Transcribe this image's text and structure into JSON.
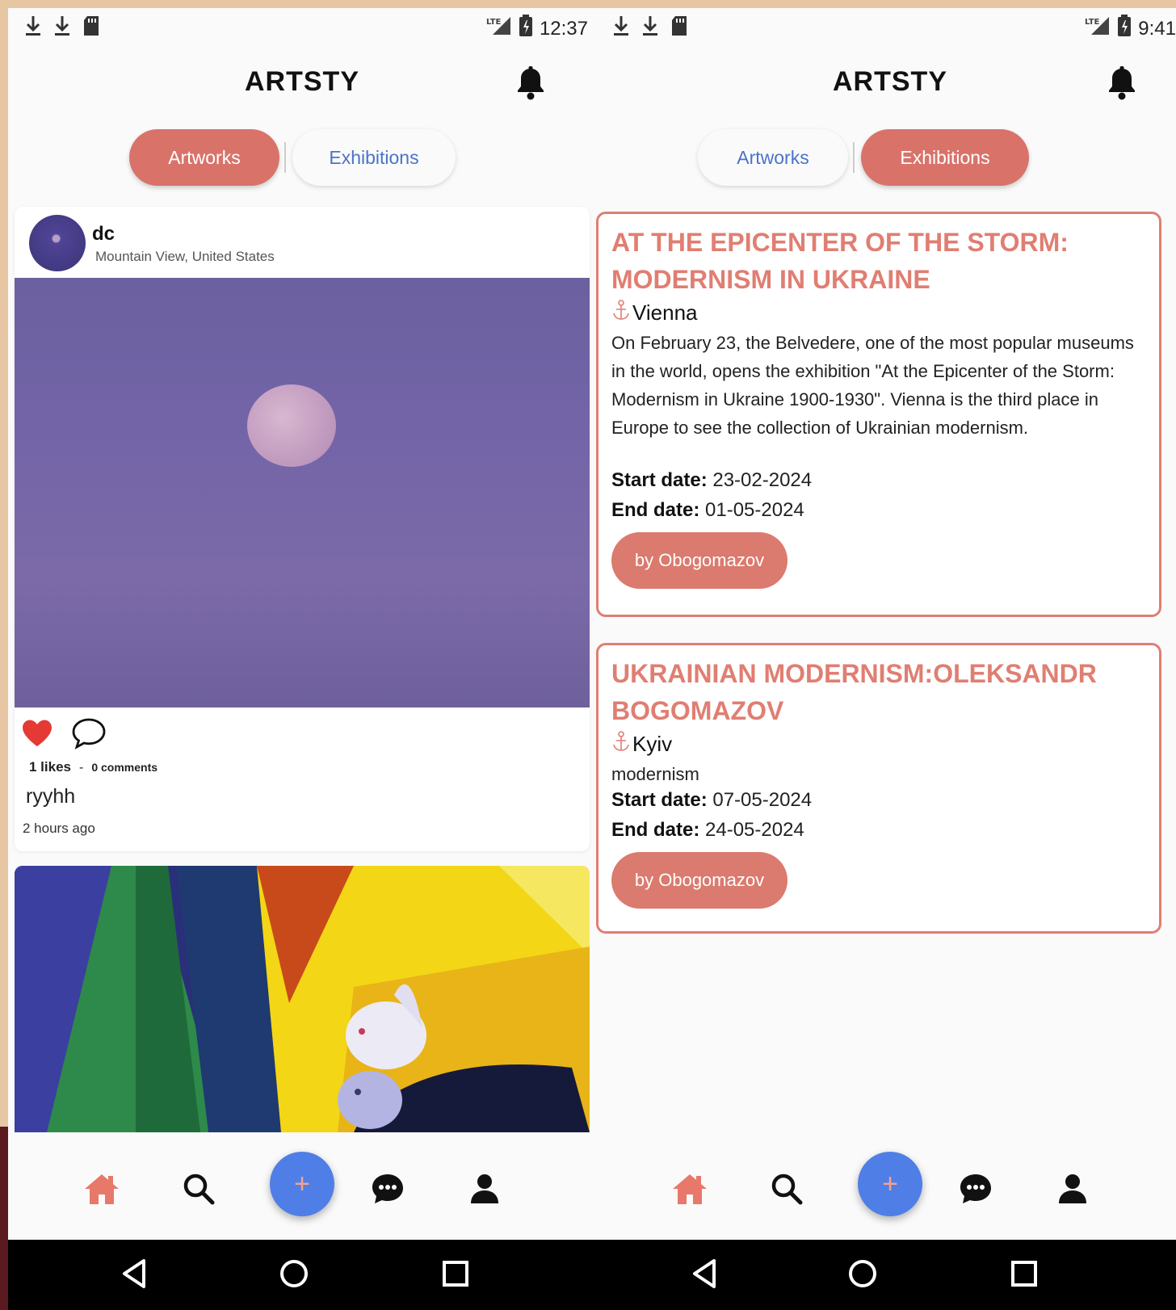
{
  "colors": {
    "accent": "#d9736a",
    "tab_inactive_text": "#4a73c9",
    "fab": "#4f7fe6",
    "home_icon": "#e8786a"
  },
  "left_screen": {
    "status": {
      "time": "12:37",
      "network": "LTE"
    },
    "title": "ARTSTY",
    "tabs": {
      "artworks": "Artworks",
      "exhibitions": "Exhibitions",
      "active": "Artworks"
    },
    "post": {
      "username": "dc",
      "location": "Mountain View, United States",
      "likes": "1 likes",
      "separator": "-",
      "comments": "0 comments",
      "caption": "ryyhh",
      "time_ago": "2 hours ago"
    }
  },
  "right_screen": {
    "status": {
      "time": "9:41",
      "network": "LTE"
    },
    "title": "ARTSTY",
    "tabs": {
      "artworks": "Artworks",
      "exhibitions": "Exhibitions",
      "active": "Exhibitions"
    },
    "exhibitions": [
      {
        "title": "AT THE EPICENTER OF THE STORM: MODERNISM IN UKRAINE",
        "city": "Vienna",
        "description": "On February 23, the Belvedere, one of the most popular museums in the world, opens the exhibition \"At the Epicenter of the Storm: Modernism in Ukraine 1900-1930\". Vienna is the third place in Europe to see the collection of Ukrainian modernism.",
        "start_label": "Start date:",
        "start_date": "23-02-2024",
        "end_label": "End date:",
        "end_date": "01-05-2024",
        "button": "by Obogomazov"
      },
      {
        "title": "UKRAINIAN MODERNISM:OLEKSANDR BOGOMAZOV",
        "city": "Kyiv",
        "description": "modernism",
        "start_label": "Start date:",
        "start_date": "07-05-2024",
        "end_label": "End date:",
        "end_date": "24-05-2024",
        "button": "by Obogomazov"
      }
    ]
  },
  "bottom_nav": {
    "icons": [
      "home-icon",
      "search-icon",
      "add-icon",
      "chat-icon",
      "profile-icon"
    ],
    "fab_symbol": "+"
  }
}
